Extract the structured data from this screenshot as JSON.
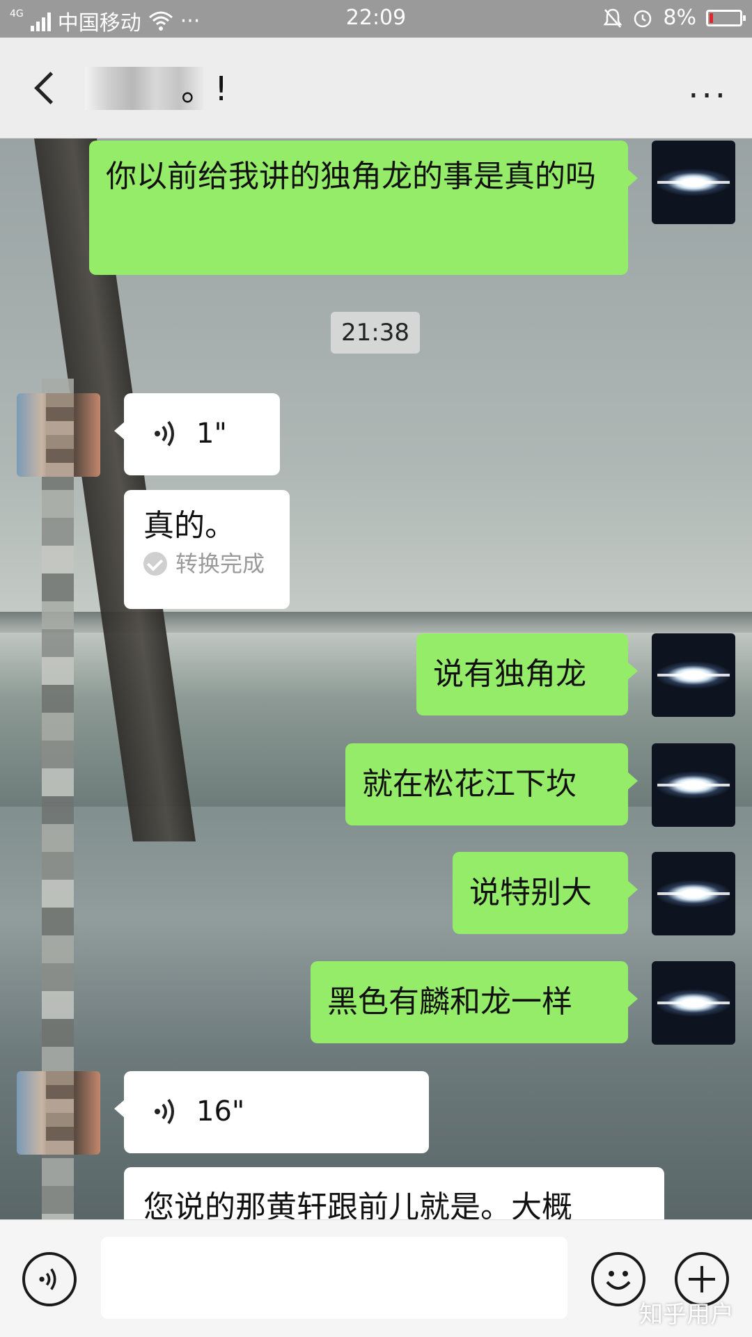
{
  "status_bar": {
    "network": "4G",
    "carrier": "中国移动",
    "extra": "···",
    "time": "22:09",
    "battery": "8%"
  },
  "header": {
    "title": "。!",
    "more_label": "···"
  },
  "chat": {
    "timestamp": "21:38",
    "messages": [
      {
        "from": "me",
        "type": "text",
        "text": "你以前给我讲的独角龙的事是真的吗"
      },
      {
        "from": "her",
        "type": "voice",
        "duration": "1\""
      },
      {
        "from": "her",
        "type": "transcript",
        "text": "真的。",
        "status": "转换完成"
      },
      {
        "from": "me",
        "type": "text",
        "text": "说有独角龙"
      },
      {
        "from": "me",
        "type": "text",
        "text": "就在松花江下坎"
      },
      {
        "from": "me",
        "type": "text",
        "text": "说特别大"
      },
      {
        "from": "me",
        "type": "text",
        "text": "黑色有麟和龙一样"
      },
      {
        "from": "her",
        "type": "voice",
        "duration": "16\""
      },
      {
        "from": "her",
        "type": "transcript",
        "text": "您说的那黄轩跟前儿就是。大概"
      }
    ]
  },
  "input_bar": {
    "input_value": "",
    "watermark": "知乎用户"
  },
  "colors": {
    "my_bubble": "#95ec69",
    "her_bubble": "#ffffff",
    "status_bar": "#9a9a9a",
    "header": "#ededed"
  }
}
